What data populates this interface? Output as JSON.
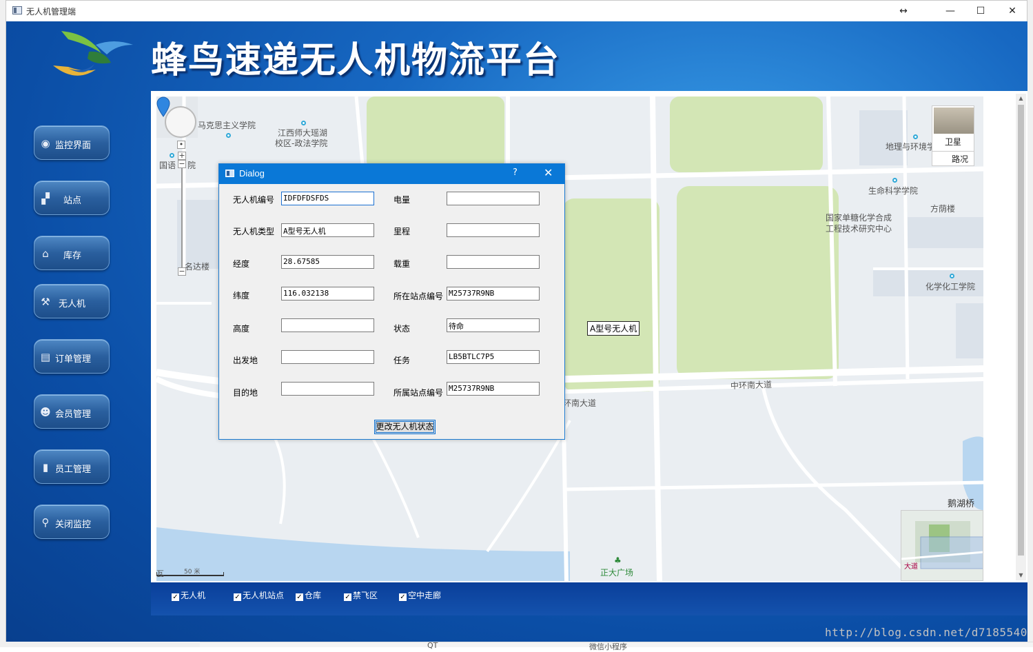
{
  "window": {
    "title": "无人机管理端",
    "controls": {
      "resize": "↔",
      "minimize": "—",
      "maximize": "☐",
      "close": "✕"
    }
  },
  "header": {
    "title": "蜂鸟速递无人机物流平台"
  },
  "nav": [
    {
      "label": "监控界面",
      "icon": "eye-icon",
      "glyph": "◉"
    },
    {
      "label": "站点",
      "icon": "station-icon",
      "glyph": "▞"
    },
    {
      "label": "库存",
      "icon": "warehouse-icon",
      "glyph": "⌂"
    },
    {
      "label": "无人机",
      "icon": "tools-icon",
      "glyph": "⚒"
    },
    {
      "label": "订单管理",
      "icon": "order-icon",
      "glyph": "▤"
    },
    {
      "label": "会员管理",
      "icon": "members-icon",
      "glyph": "☻"
    },
    {
      "label": "员工管理",
      "icon": "staff-icon",
      "glyph": "▮"
    },
    {
      "label": "关闭监控",
      "icon": "close-monitor-icon",
      "glyph": "⚲"
    }
  ],
  "map": {
    "labels": {
      "marx": "马克思主义学院",
      "jxnu": "江西师大瑶湖",
      "law": "校区-政法学院",
      "foreign": "国语",
      "foreign_tail": "院",
      "mingda": "名达楼",
      "geo": "地理与环境学",
      "life": "生命科学学院",
      "fangyin": "方荫楼",
      "sugar1": "国家单糖化学合成",
      "sugar2": "工程技术研究中心",
      "chem": "化学化工学院",
      "road1": "中环南大道",
      "road2": "环南大道",
      "bridge": "鹅湖桥",
      "square": "正大广场",
      "scale": "50 米",
      "overview_label": "大道",
      "bottom_road": "瓦"
    },
    "map_type": {
      "satellite": "卫星",
      "road": "路况"
    },
    "marker_label": "A型号无人机"
  },
  "layers": [
    {
      "label": "无人机",
      "checked": true
    },
    {
      "label": "无人机站点",
      "checked": true
    },
    {
      "label": "仓库",
      "checked": true
    },
    {
      "label": "禁飞区",
      "checked": true
    },
    {
      "label": "空中走廊",
      "checked": true
    }
  ],
  "dialog": {
    "title": "Dialog",
    "help": "?",
    "close": "✕",
    "fields_left": [
      {
        "label": "无人机编号",
        "value": "IDFDFDSFDS"
      },
      {
        "label": "无人机类型",
        "value": "A型号无人机"
      },
      {
        "label": "经度",
        "value": "28.67585"
      },
      {
        "label": "纬度",
        "value": "116.032138"
      },
      {
        "label": "高度",
        "value": ""
      },
      {
        "label": "出发地",
        "value": ""
      },
      {
        "label": "目的地",
        "value": ""
      }
    ],
    "fields_right": [
      {
        "label": "电量",
        "value": ""
      },
      {
        "label": "里程",
        "value": ""
      },
      {
        "label": "载重",
        "value": ""
      },
      {
        "label": "所在站点编号",
        "value": "M25737R9NB"
      },
      {
        "label": "状态",
        "value": "待命"
      },
      {
        "label": "任务",
        "value": "LB5BTLC7P5"
      },
      {
        "label": "所属站点编号",
        "value": "M25737R9NB"
      }
    ],
    "button": "更改无人机状态"
  },
  "watermark": "http://blog.csdn.net/d7185540",
  "background_peek": {
    "item1": "QT",
    "item2": "微信小程序"
  }
}
